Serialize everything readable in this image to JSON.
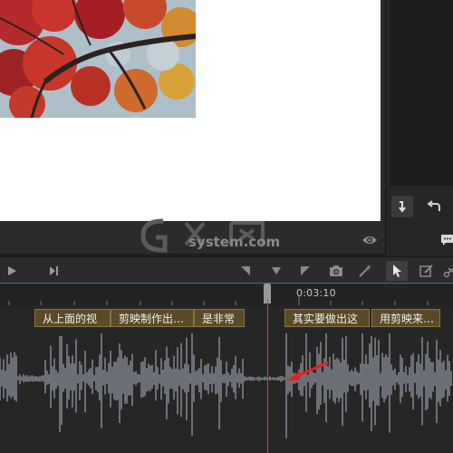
{
  "watermark": {
    "brand_mark": "GXI网",
    "site": "system.com"
  },
  "ruler": {
    "timecode": "0:03:10"
  },
  "subtitles": [
    {
      "text": "从上面的视"
    },
    {
      "text": "剪映制作出…"
    },
    {
      "text": "是非常"
    },
    {
      "text": "其实要做出这"
    },
    {
      "text": "用剪映来…"
    }
  ],
  "colors": {
    "subtitle_bg": "#5a4a26",
    "playhead": "#e03c3c",
    "waveform": "#8b9199",
    "arrow": "#e82020",
    "ruler_accent": "#3c6fae"
  },
  "icons": {
    "toolbar": [
      "play-icon",
      "next-frame-icon",
      "mark-in-icon",
      "marker-icon",
      "mark-out-icon",
      "camera-icon",
      "magic-wand-icon",
      "cursor-icon",
      "edit-icon",
      "scissors-icon"
    ],
    "right_panel": [
      "import-icon",
      "undo-icon",
      "comment-icon"
    ],
    "preview": [
      "eye-icon"
    ]
  }
}
